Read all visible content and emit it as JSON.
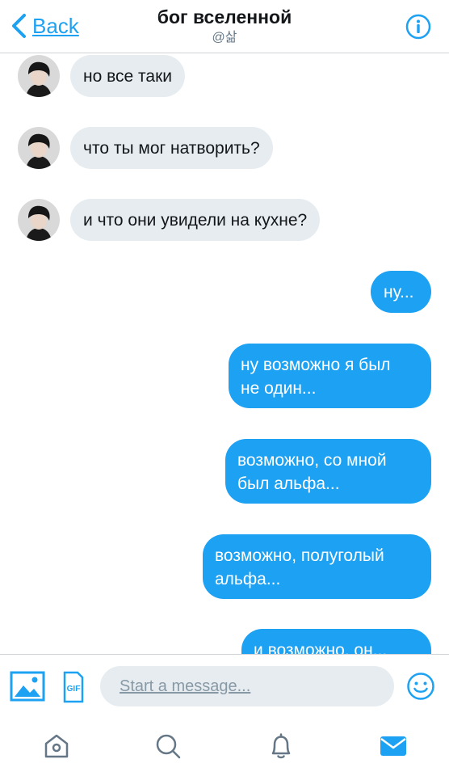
{
  "header": {
    "back_label": "Back",
    "title": "бог вселенной",
    "handle": "@삶"
  },
  "messages": [
    {
      "direction": "incoming",
      "text": "но все таки"
    },
    {
      "direction": "incoming",
      "text": "что ты мог натворить?"
    },
    {
      "direction": "incoming",
      "text": "и что они увидели на кухне?"
    },
    {
      "direction": "outgoing",
      "text": "ну..."
    },
    {
      "direction": "outgoing",
      "lines": [
        "ну возможно я был",
        "не один..."
      ]
    },
    {
      "direction": "outgoing",
      "lines": [
        "возможно, со мной",
        "был альфа..."
      ]
    },
    {
      "direction": "outgoing",
      "lines": [
        "возможно, полуголый",
        "альфа..."
      ]
    },
    {
      "direction": "outgoing",
      "text": "и возможно, он..."
    }
  ],
  "composer": {
    "placeholder": "Start a message...",
    "value": "",
    "media_icon": "image-icon",
    "gif_icon": "gif-icon",
    "emoji_icon": "emoji-icon"
  },
  "tabs": [
    {
      "icon": "home-icon",
      "active": false
    },
    {
      "icon": "search-icon",
      "active": false
    },
    {
      "icon": "notifications-bell-icon",
      "active": false
    },
    {
      "icon": "messages-envelope-icon",
      "active": true
    }
  ],
  "colors": {
    "accent": "#1da1f2",
    "incoming_bubble": "#e6ecf0",
    "inactive_icon": "#657786"
  }
}
